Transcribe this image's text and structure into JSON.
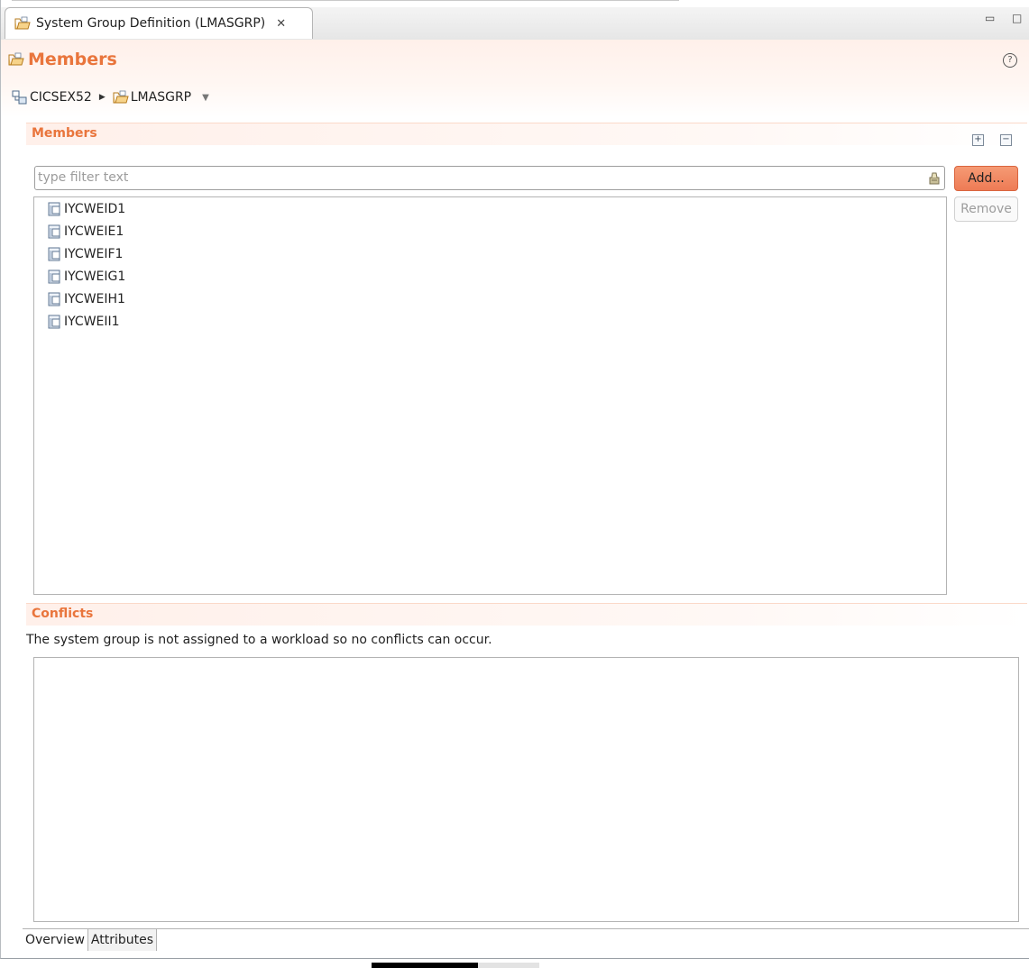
{
  "editor_tab": {
    "title": "System Group Definition (LMASGRP)",
    "close": "✕"
  },
  "window_controls": {
    "minimize": "▭",
    "maximize": "□"
  },
  "header": {
    "title": "Members",
    "help": "?"
  },
  "breadcrumb": {
    "root": "CICSEX52",
    "current": "LMASGRP"
  },
  "members_section": {
    "title": "Members",
    "expand_all": "+",
    "collapse_all": "−",
    "filter_placeholder": "type filter text",
    "add_label": "Add...",
    "remove_label": "Remove",
    "items": [
      "IYCWEID1",
      "IYCWEIE1",
      "IYCWEIF1",
      "IYCWEIG1",
      "IYCWEIH1",
      "IYCWEII1"
    ]
  },
  "conflicts_section": {
    "title": "Conflicts",
    "message": "The system group is not assigned to a workload so no conflicts can occur."
  },
  "bottom_tabs": [
    "Overview",
    "Attributes"
  ],
  "colors": {
    "accent": "#e9753c",
    "add_button": "#f08a62"
  }
}
